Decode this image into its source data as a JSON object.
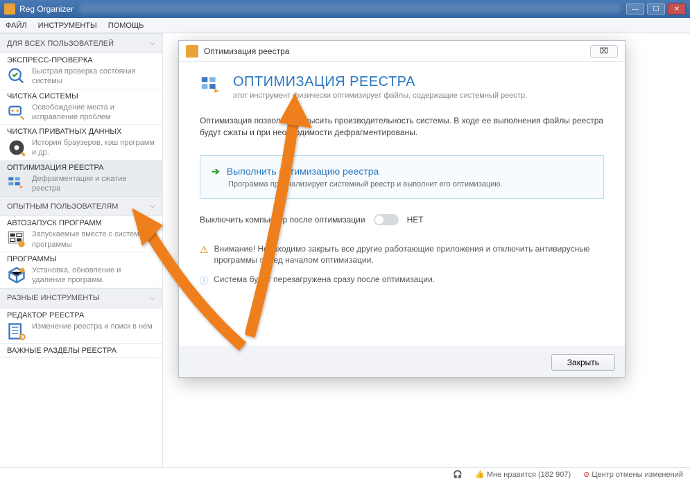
{
  "titlebar": {
    "app_name": "Reg Organizer"
  },
  "menubar": {
    "file": "ФАЙЛ",
    "tools": "ИНСТРУМЕНТЫ",
    "help": "ПОМОЩЬ"
  },
  "sections": {
    "all_users": "ДЛЯ ВСЕХ ПОЛЬЗОВАТЕЛЕЙ",
    "advanced": "ОПЫТНЫМ ПОЛЬЗОВАТЕЛЯМ",
    "misc": "РАЗНЫЕ ИНСТРУМЕНТЫ"
  },
  "items": {
    "express": {
      "title": "ЭКСПРЕСС-ПРОВЕРКА",
      "desc": "Быстрая проверка состояния системы"
    },
    "clean": {
      "title": "ЧИСТКА СИСТЕМЫ",
      "desc": "Освобождение места и исправление проблем"
    },
    "private": {
      "title": "ЧИСТКА ПРИВАТНЫХ ДАННЫХ",
      "desc": "История браузеров, кэш программ и др."
    },
    "optimize": {
      "title": "ОПТИМИЗАЦИЯ РЕЕСТРА",
      "desc": "Дефрагментация и сжатие реестра"
    },
    "autorun": {
      "title": "АВТОЗАПУСК ПРОГРАММ",
      "desc": "Запускаемые вместе с системой программы"
    },
    "programs": {
      "title": "ПРОГРАММЫ",
      "desc": "Установка, обновление и удаление программ."
    },
    "regedit": {
      "title": "РЕДАКТОР РЕЕСТРА",
      "desc": "Изменение реестра и поиск в нем"
    },
    "important": {
      "title": "ВАЖНЫЕ РАЗДЕЛЫ РЕЕСТРА"
    }
  },
  "dialog": {
    "window_title": "Оптимизация реестра",
    "title": "ОПТИМИЗАЦИЯ РЕЕСТРА",
    "subtitle": "этот инструмент физически оптимизирует файлы, содержащие системный реестр.",
    "body": "Оптимизация позволяет повысить производительность системы. В ходе ее выполнения файлы реестра будут сжаты и при необходимости дефрагментированы.",
    "action_title": "Выполнить оптимизацию реестра",
    "action_sub": "Программа проанализирует системный реестр и выполнит его оптимизацию.",
    "toggle_label": "Выключить компьютер после оптимизации",
    "toggle_value": "НЕТ",
    "warn": "Внимание! Необходимо закрыть все другие работающие приложения и отключить антивирусные программы перед началом оптимизации.",
    "reboot": "Система будет перезагружена сразу после оптимизации.",
    "close": "Закрыть"
  },
  "statusbar": {
    "like": "Мне нравится (182 907)",
    "undo": "Центр отмены изменений"
  }
}
